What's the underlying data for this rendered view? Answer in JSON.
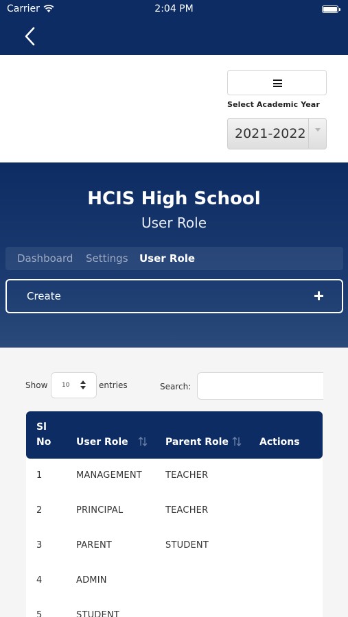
{
  "status_bar": {
    "carrier": "Carrier",
    "time": "2:04 PM"
  },
  "nav": {
    "back_icon": "chevron-left-icon"
  },
  "year": {
    "menu_icon": "hamburger-menu-icon",
    "label": "Select Academic Year",
    "selected": "2021-2022"
  },
  "hero": {
    "school": "HCIS High School",
    "page_title": "User Role"
  },
  "breadcrumb": {
    "items": [
      "Dashboard",
      "Settings",
      "User Role"
    ]
  },
  "create": {
    "label": "Create"
  },
  "table_controls": {
    "show_label": "Show",
    "entries_value": "10",
    "entries_label": "entries",
    "search_label": "Search:",
    "search_value": ""
  },
  "table": {
    "headers": {
      "sl_line1": "Sl",
      "sl_line2": "No",
      "role": "User Role",
      "parent": "Parent Role",
      "actions": "Actions"
    },
    "rows": [
      {
        "no": "1",
        "role": "MANAGEMENT",
        "parent": "TEACHER"
      },
      {
        "no": "2",
        "role": "PRINCIPAL",
        "parent": "TEACHER"
      },
      {
        "no": "3",
        "role": "PARENT",
        "parent": "STUDENT"
      },
      {
        "no": "4",
        "role": "ADMIN",
        "parent": ""
      },
      {
        "no": "5",
        "role": "STUDENT",
        "parent": ""
      }
    ]
  },
  "colors": {
    "primary": "#0c2c63",
    "background": "#f5f5f5"
  }
}
